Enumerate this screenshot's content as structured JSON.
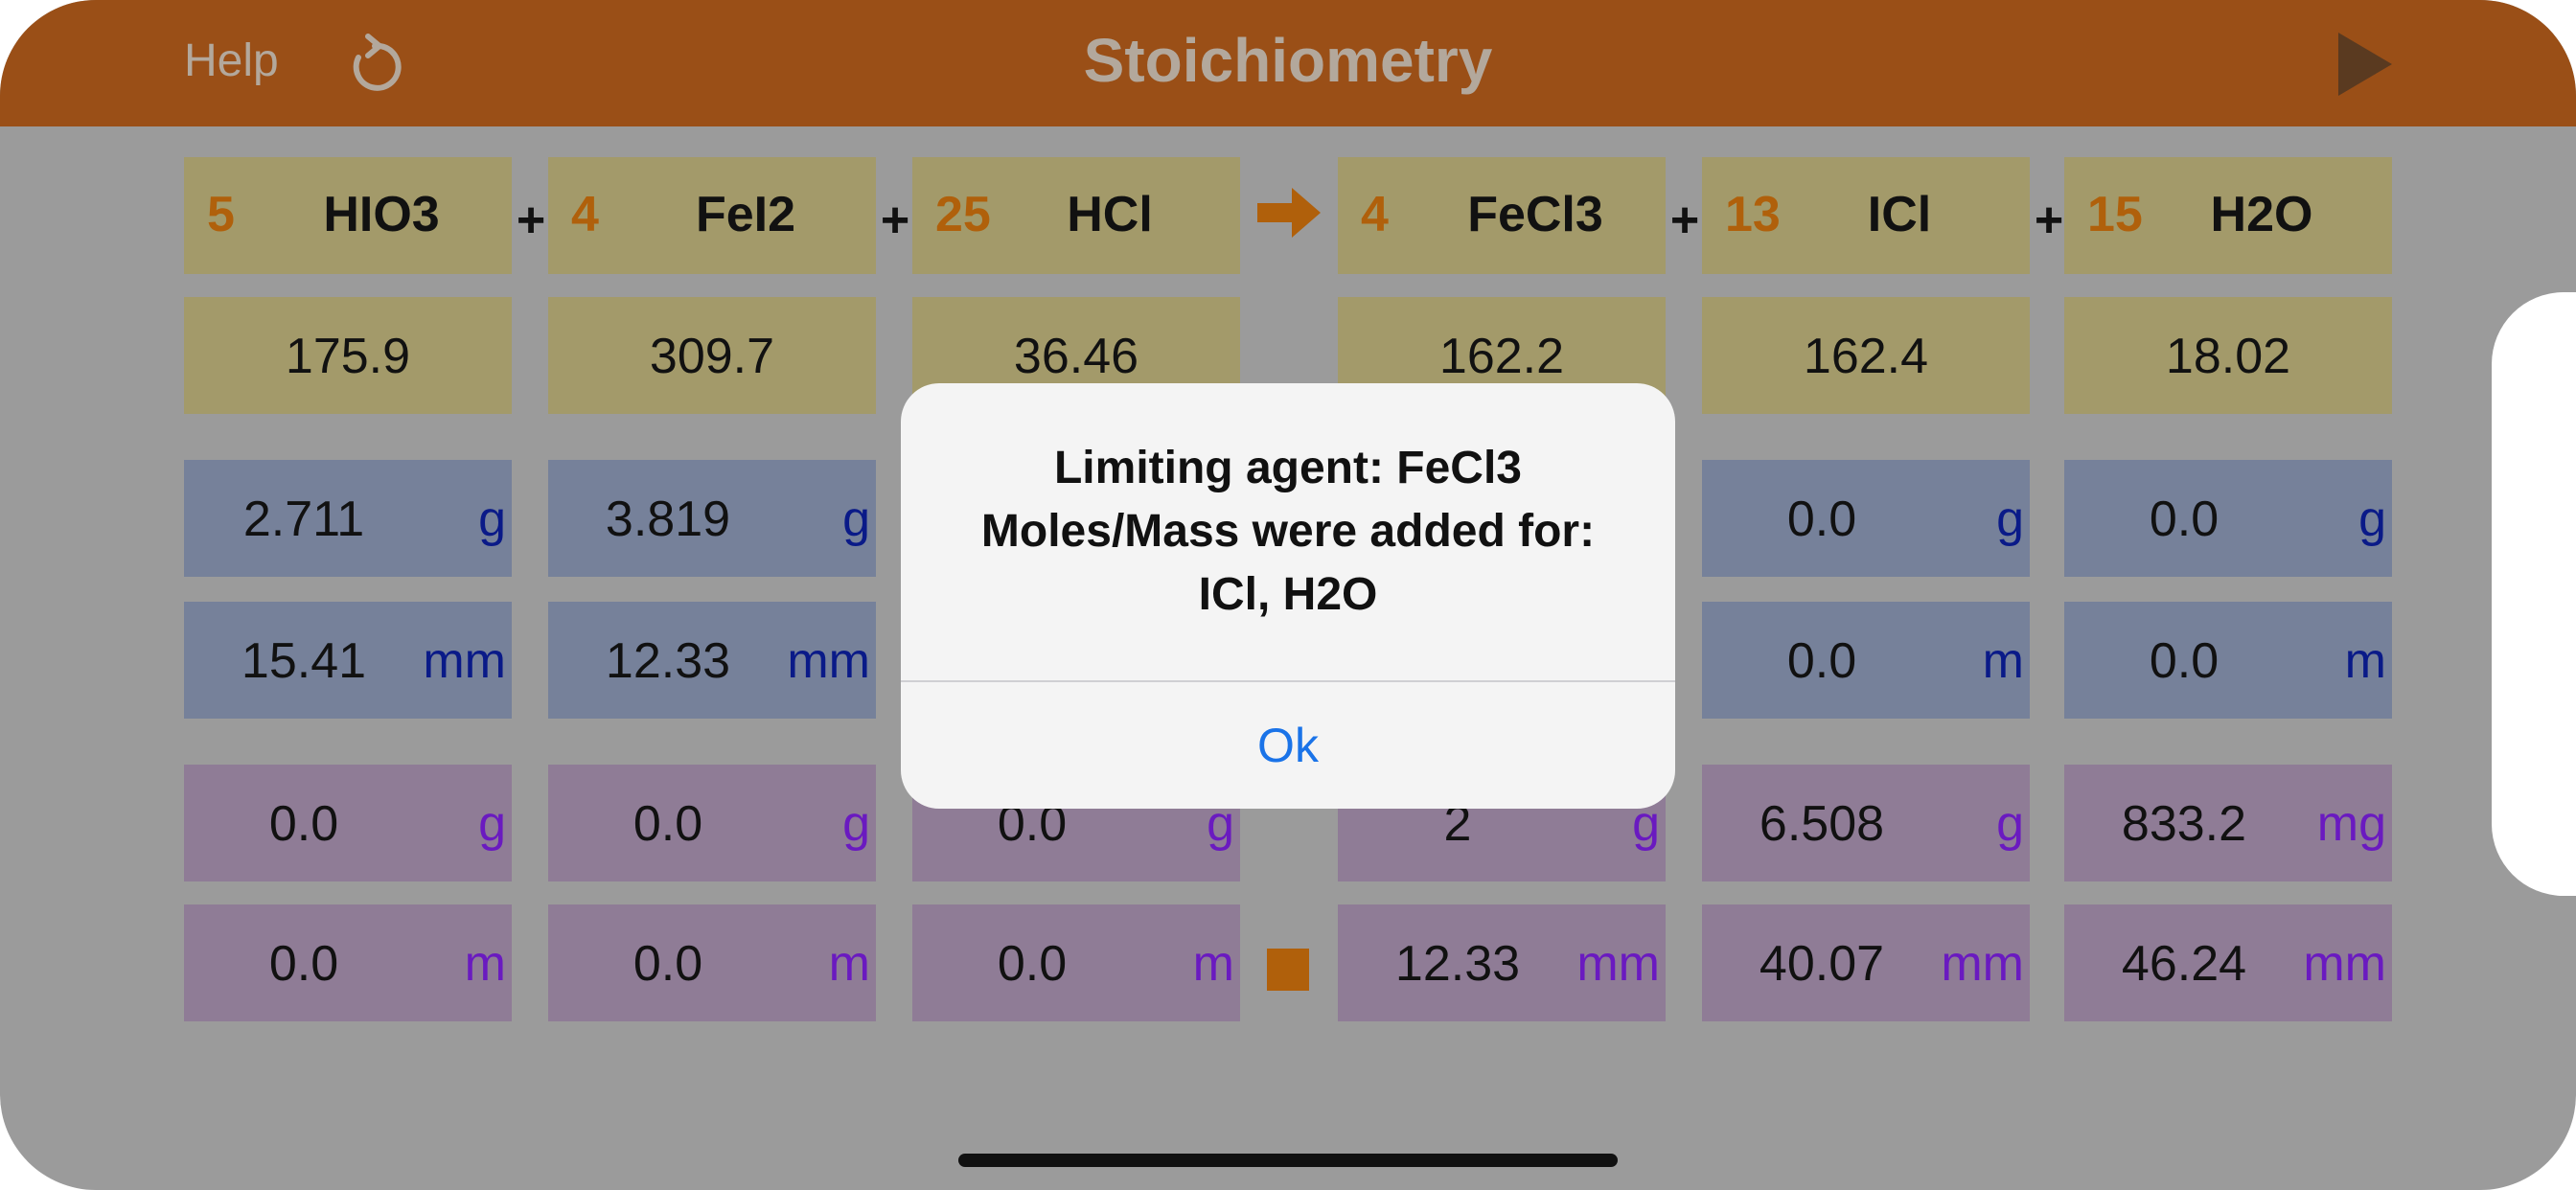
{
  "navbar": {
    "help_label": "Help",
    "title": "Stoichiometry",
    "refresh_icon": "refresh-icon",
    "play_icon": "play-icon",
    "color": "#9a4f17"
  },
  "equation": {
    "reactants": [
      {
        "coef": "5",
        "formula": "HIO3"
      },
      {
        "coef": "4",
        "formula": "FeI2"
      },
      {
        "coef": "25",
        "formula": "HCl"
      }
    ],
    "products": [
      {
        "coef": "4",
        "formula": "FeCl3"
      },
      {
        "coef": "13",
        "formula": "ICl"
      },
      {
        "coef": "15",
        "formula": "H2O"
      }
    ],
    "plus": "+",
    "arrow_icon": "arrow-right-icon"
  },
  "molar_masses": [
    "175.9",
    "309.7",
    "36.46",
    "162.2",
    "162.4",
    "18.02"
  ],
  "input_mass": [
    {
      "value": "2.711",
      "unit": "g"
    },
    {
      "value": "3.819",
      "unit": "g"
    },
    {
      "value": "",
      "unit": ""
    },
    {
      "value": "",
      "unit": ""
    },
    {
      "value": "0.0",
      "unit": "g"
    },
    {
      "value": "0.0",
      "unit": "g"
    }
  ],
  "input_moles": [
    {
      "value": "15.41",
      "unit": "mm"
    },
    {
      "value": "12.33",
      "unit": "mm"
    },
    {
      "value": "",
      "unit": ""
    },
    {
      "value": "",
      "unit": ""
    },
    {
      "value": "0.0",
      "unit": "m"
    },
    {
      "value": "0.0",
      "unit": "m"
    }
  ],
  "result_mass": [
    {
      "value": "0.0",
      "unit": "g"
    },
    {
      "value": "0.0",
      "unit": "g"
    },
    {
      "value": "0.0",
      "unit": "g"
    },
    {
      "value": "2",
      "unit": "g"
    },
    {
      "value": "6.508",
      "unit": "g"
    },
    {
      "value": "833.2",
      "unit": "mg"
    }
  ],
  "result_moles": [
    {
      "value": "0.0",
      "unit": "m"
    },
    {
      "value": "0.0",
      "unit": "m"
    },
    {
      "value": "0.0",
      "unit": "m"
    },
    {
      "value": "12.33",
      "unit": "mm"
    },
    {
      "value": "40.07",
      "unit": "mm"
    },
    {
      "value": "46.24",
      "unit": "mm"
    }
  ],
  "stop_icon": "stop-icon",
  "alert": {
    "line1": "Limiting agent: FeCl3",
    "line2": "Moles/Mass were added for:",
    "line3": "ICl, H2O",
    "ok_label": "Ok"
  },
  "colors": {
    "olive": "#a39a6a",
    "blue": "#76819a",
    "purple": "#8f7c96",
    "coefficient": "#b0600b",
    "link": "#1a73e8"
  }
}
